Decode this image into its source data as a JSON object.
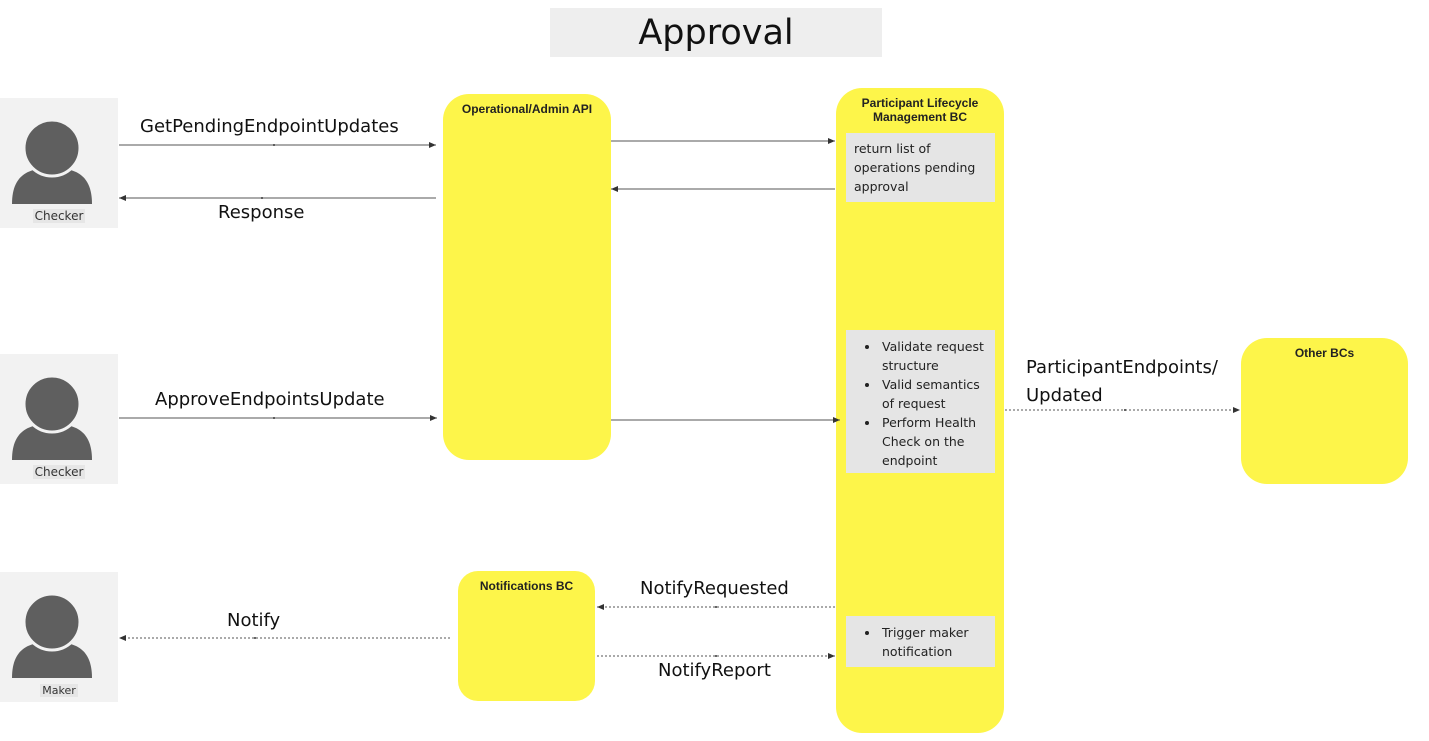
{
  "title": "Approval",
  "actors": [
    {
      "label": "Checker",
      "icon": "person-icon"
    },
    {
      "label": "Checker",
      "icon": "person-icon"
    },
    {
      "label": "Maker",
      "icon": "person-icon"
    }
  ],
  "components": {
    "admin_api": {
      "title": "Operational/Admin API"
    },
    "plm_bc": {
      "title_line1": "Participant Lifecycle",
      "title_line2": "Management BC"
    },
    "other_bcs": {
      "title": "Other BCs"
    },
    "notifications_bc": {
      "title": "Notifications BC"
    }
  },
  "notes": {
    "pending_list": "return list of operations pending approval",
    "validation": [
      "Validate request structure",
      "Valid semantics of request",
      "Perform Health Check on the endpoint"
    ],
    "trigger": [
      "Trigger maker notification"
    ]
  },
  "messages": {
    "get_pending": "GetPendingEndpointUpdates",
    "response": "Response",
    "approve": "ApproveEndpointsUpdate",
    "participant_endpoints_line1": "ParticipantEndpoints/",
    "participant_endpoints_line2": "Updated",
    "notify_requested": "NotifyRequested",
    "notify": "Notify",
    "notify_report": "NotifyReport"
  }
}
